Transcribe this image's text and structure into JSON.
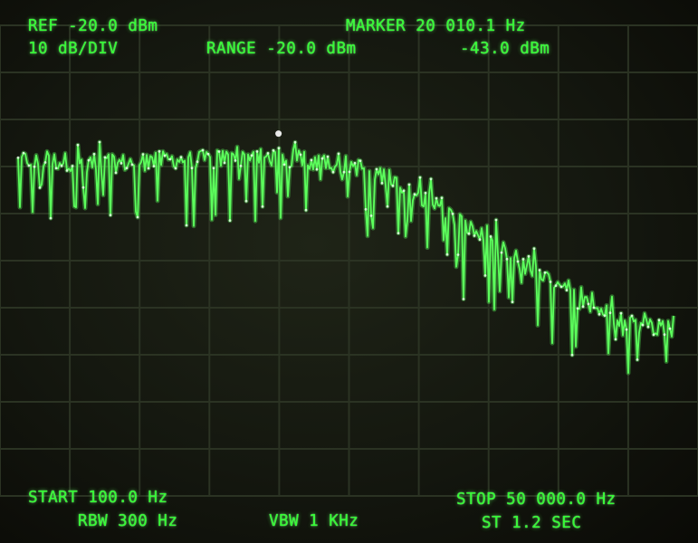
{
  "readouts": {
    "ref": "REF -20.0 dBm",
    "scale": "10 dB/DIV",
    "range": "RANGE -20.0 dBm",
    "marker_freq": "MARKER 20 010.1 Hz",
    "marker_level": "-43.0 dBm",
    "start": "START 100.0 Hz",
    "rbw": "RBW 300 Hz",
    "vbw": "VBW 1 KHz",
    "stop": "STOP 50 000.0 Hz",
    "sweep_time": "ST 1.2 SEC"
  },
  "display": {
    "trace_color": "#5cff5c",
    "text_color": "#33ff33",
    "grid_color": "#2b3323",
    "background": "#14170f"
  },
  "chart_data": {
    "type": "line",
    "x_unit": "Hz",
    "y_unit": "dBm",
    "xlim": [
      100.0,
      50000.0
    ],
    "ylim": [
      -120.0,
      -20.0
    ],
    "grid": true,
    "marker": {
      "x": 20010.1,
      "y": -43.0
    },
    "x": [
      100,
      2600,
      5100,
      7600,
      10100,
      12600,
      15100,
      17600,
      20100,
      22600,
      25100,
      27600,
      30100,
      32600,
      35100,
      37600,
      40100,
      42600,
      45100,
      47600,
      50000
    ],
    "y": [
      -49,
      -48.5,
      -49,
      -49.5,
      -49,
      -48.5,
      -48.5,
      -48,
      -48,
      -49,
      -49.5,
      -52,
      -56,
      -61,
      -66,
      -71,
      -76,
      -80,
      -83,
      -84.5,
      -85.5
    ]
  }
}
